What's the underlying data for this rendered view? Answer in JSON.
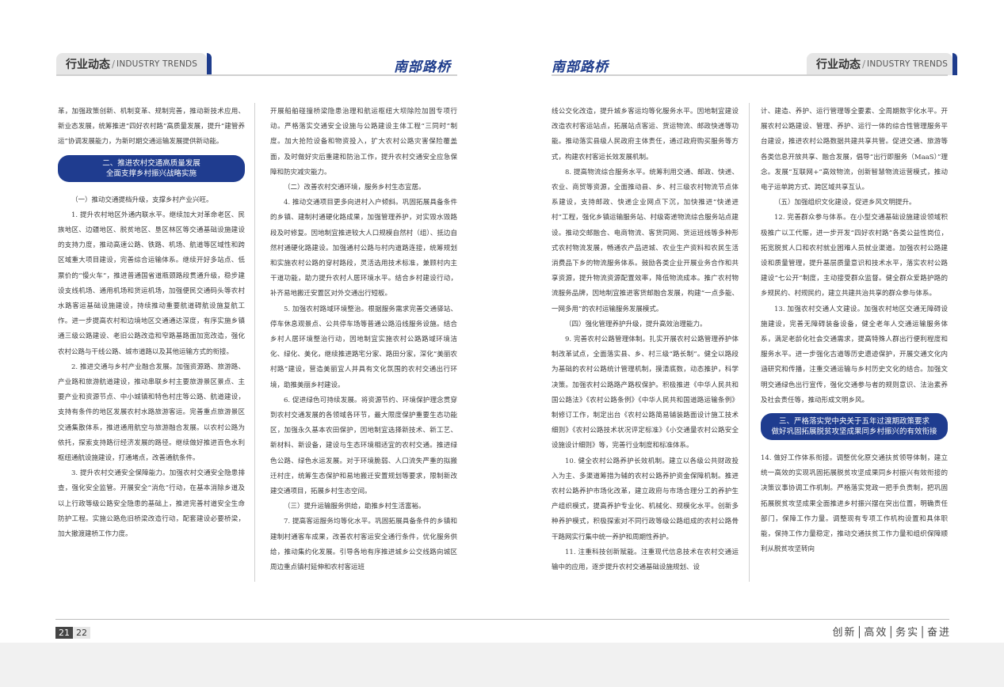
{
  "header": {
    "section_zh": "行业动态",
    "section_sep": "/",
    "section_en": "INDUSTRY TRENDS",
    "brand": "南部路桥"
  },
  "col1": {
    "p0": "革，加强政策创新、机制变革、规制完善，推动新技术应用、新业态发展，统筹推进“四好农村路”高质量发展，提升“建管养运”协调发展能力，为新时期交通运输发展提供新动能。",
    "pill": "二、推进农村交通高质量发展\n全面支撑乡村振兴战略实施",
    "s1": "（一）推动交通提档升级，支撑乡村产业兴旺。",
    "p1": "1. 提升农村地区外通内联水平。继续加大对革命老区、民族地区、边疆地区、脱贫地区、垦区林区等交通基础设施建设的支持力度，推动高速公路、铁路、机场、航道等区域性和跨区域重大项目建设，完善综合运输体系。继续开好多站点、低票价的“慢火车”，推进普通国省道瓶颈路段贯通升级，稳步建设支线机场、通用机场和货运机场，加强便民交通码头等农村水路客运基础设施建设，持续推动重要航道碍航设施复航工作。进一步提高农村和边境地区交通通达深度，有序实施乡镇通三级公路建设、老旧公路改造和窄路基路面加宽改造，强化农村公路与干线公路、城市道路以及其他运输方式的衔接。",
    "p2": "2. 推进交通与乡村产业融合发展。加强资源路、旅游路、产业路和旅游航道建设，推动串联乡村主要旅游景区景点、主要产业和资源节点、中小城镇和特色村庄等公路、航道建设，支持有条件的地区发展农村水路旅游客运。完善重点旅游景区交通集散体系，推进通用航空与旅游融合发展。以农村公路为依托，探索支持路衍经济发展的路径。继续做好推进百色水利枢纽通航设施建设，打通堵点，改善通航条件。",
    "p3": "3. 提升农村交通安全保障能力。加强农村交通安全隐患排查，强化安全监管。开展安全“消危”行动，在基本消除乡道及以上行政等级公路安全隐患的基础上，推进完善村道安全生命防护工程。实施公路危旧桥梁改造行动，配套建设必要桥梁，加大撤渡建桥工作力度。"
  },
  "col2": {
    "p0": "开展船舶碰撞桥梁隐患治理和航运枢纽大坝除险加固专项行动。严格落实交通安全设施与公路建设主体工程“三同时”制度。加大抢险设备和物资投入，扩大农村公路灾害保险覆盖面，及时做好灾后重建和防治工作，提升农村交通安全应急保障和防灾减灾能力。",
    "s2": "（二）改善农村交通环境，服务乡村生态宜居。",
    "p4": "4. 推动交通项目更多向进村入户倾斜。巩固拓展具备条件的乡镇、建制村通硬化路成果，加强管理养护，对实毁水毁路段及时修复。因地制宜推进较大人口规模自然村（组）、抵边自然村通硬化路建设。加强通村公路与村内道路连接，统筹规划和实施农村公路的穿村路段，灵活选用技术标准，兼顾村内主干道功能，助力提升农村人居环境水平。结合乡村建设行动，补齐易地搬迁安置区对外交通出行短板。",
    "p5": "5. 加强农村路域环境整治。根据服务需求完善交通驿站、停车休息观景点、公共停车场等普通公路沿线服务设施。结合乡村人居环境整治行动，因地制宜实施农村公路路域环境洁化、绿化、美化，继续推进路宅分家、路田分家，深化“美丽农村路”建设，营造美丽宜人并具有文化氛围的农村交通出行环境，助推美丽乡村建设。",
    "p6": "6. 促进绿色可持续发展。将资源节约、环境保护理念贯穿到农村交通发展的各领域各环节，最大限度保护重要生态功能区，加强永久基本农田保护，因地制宜选择新技术、新工艺、新材料、新设备，建设与生态环境相适宜的农村交通。推进绿色公路、绿色水运发展。对于环境脆弱、人口流失严重的拟搬迁村庄，统筹生态保护和易地搬迁安置规划等要求，限制新改建交通项目，拓展乡村生态空间。",
    "s3": "（三）提升运输服务供给，助推乡村生活富裕。",
    "p7": "7. 提高客运服务均等化水平。巩固拓展具备条件的乡镇和建制村通客车成果，改善农村客运安全通行条件，优化服务供给，推动集约化发展。引导各地有序推进城乡公交线路向城区周边重点镇村延伸和农村客运班"
  },
  "col3": {
    "p0": "线公交化改造，提升城乡客运均等化服务水平。因地制宜建设改造农村客运站点，拓展站点客运、货运物流、邮政快递等功能。推动落实县级人民政府主体责任，通过政府购买服务等方式，构建农村客运长效发展机制。",
    "p8": "8. 提高物流综合服务水平。统筹利用交通、邮政、快递、农业、商贸等资源，全面推动县、乡、村三级农村物流节点体系建设，支持邮政、快递企业网点下沉，加快推进“快递进村”工程，强化乡镇运输服务站、村级寄递物流综合服务站点建设。推动交邮融合、电商物流、客货同网、货运班线等多种形式农村物流发展，畅通农产品进城、农业生产资料和农民生活消费品下乡的物流服务体系。鼓励各类企业开展业务合作和共享资源，提升物流资源配置效率，降低物流成本。推广农村物流服务品牌，因地制宜推进客货邮融合发展，构建“一点多能、一网多用”的农村运输服务发展模式。",
    "s4": "（四）强化管理养护升级，提升高效治理能力。",
    "p9": "9. 完善农村公路管理体制。扎实开展农村公路管理养护体制改革试点，全面落实县、乡、村三级“路长制”。健全以路段为基础的农村公路统计管理机制，摸清底数，动态推护，科学决策。加强农村公路路产路权保护。积极推进《中华人民共和国公路法》《农村公路条例》《中华人民共和国道路运输条例》制修订工作，制定出台《农村公路简易铺装路面设计施工技术细则》《农村公路技术状况评定标准》《小交通量农村公路安全设施设计细则》等，完善行业制度和标准体系。",
    "p10": "10. 健全农村公路养护长效机制。建立以各级公共财政投入为主、多渠道筹措为辅的农村公路养护资金保障机制。推进农村公路养护市场化改革，建立政府与市场合理分工的养护生产组织模式，提高养护专业化、机械化、规模化水平。创新多种养护模式，积极探索对不同行政等级公路组成的农村公路骨干路网实行集中统一养护和周期性养护。",
    "p11": "11. 注重科技创新赋能。注重现代信息技术在农村交通运输中的应用，逐步提升农村交通基础设施规划、设"
  },
  "col4": {
    "p0": "计、建造、养护、运行管理等全要素、全周期数字化水平。开展农村公路建设、管理、养护、运行一体的综合性管理服务平台建设，推进农村公路数据共建共享共管。促进交通、旅游等各类信息开放共享、融合发展，倡导“出行即服务（MaaS）”理念。发展“互联网+”高效物流，创新智慧物流运营模式，推动电子运单跨方式、跨区域共享互认。",
    "s5": "（五）加强组织文化建设，促进乡风文明提升。",
    "p12": "12. 完善群众参与体系。在小型交通基础设施建设领域积极推广以工代赈，进一步开发“四好农村路”各类公益性岗位，拓宽脱贫人口和农村就业困难人员就业渠道。加强农村公路建设和质量管理，提升基层质量意识和技术水平，落实农村公路建设“七公开”制度，主动接受群众监督。健全群众爱路护路的乡规民约、村规民约，建立共建共治共享的群众参与体系。",
    "p13": "13. 加强农村交通人文建设。加强农村地区交通无障碍设施建设，完善无障碍装备设备，健全老年人交通运输服务体系，满足老龄化社会交通需求，提高特殊人群出行便利程度和服务水平。进一步强化古道等历史遗迹保护，开展交通文化内涵研究和传播，注重交通运输与乡村历史文化的结合。加强文明交通绿色出行宣传，强化交通参与者的规则意识、法治素养及社会责任等，推动形成文明乡风。",
    "pill": "三、严格落实党中央关于五年过渡期政策要求\n做好巩固拓展脱贫攻坚成果同乡村振兴的有效衔接",
    "p14": "14. 做好工作体系衔接。调整优化原交通扶贫领导体制，建立统一高效的实现巩固拓展脱贫攻坚成果同乡村振兴有效衔接的决策议事协调工作机制。严格落实党政一把手负责制，把巩固拓展脱贫攻坚成果全面推进乡村振兴摆在突出位置，明确责任部门，保障工作力量。调整现有专项工作机构设置和具体职能，保持工作力量稳定，推动交通扶贫工作力量和组织保障顺利从脱贫攻坚转向"
  },
  "footer": {
    "page_left": "21",
    "page_right": "22",
    "slogan": "创新│高效│务实│奋进"
  },
  "colors": {
    "brand_blue": "#1e3c8c",
    "pill_blue": "#1f3c8f"
  }
}
